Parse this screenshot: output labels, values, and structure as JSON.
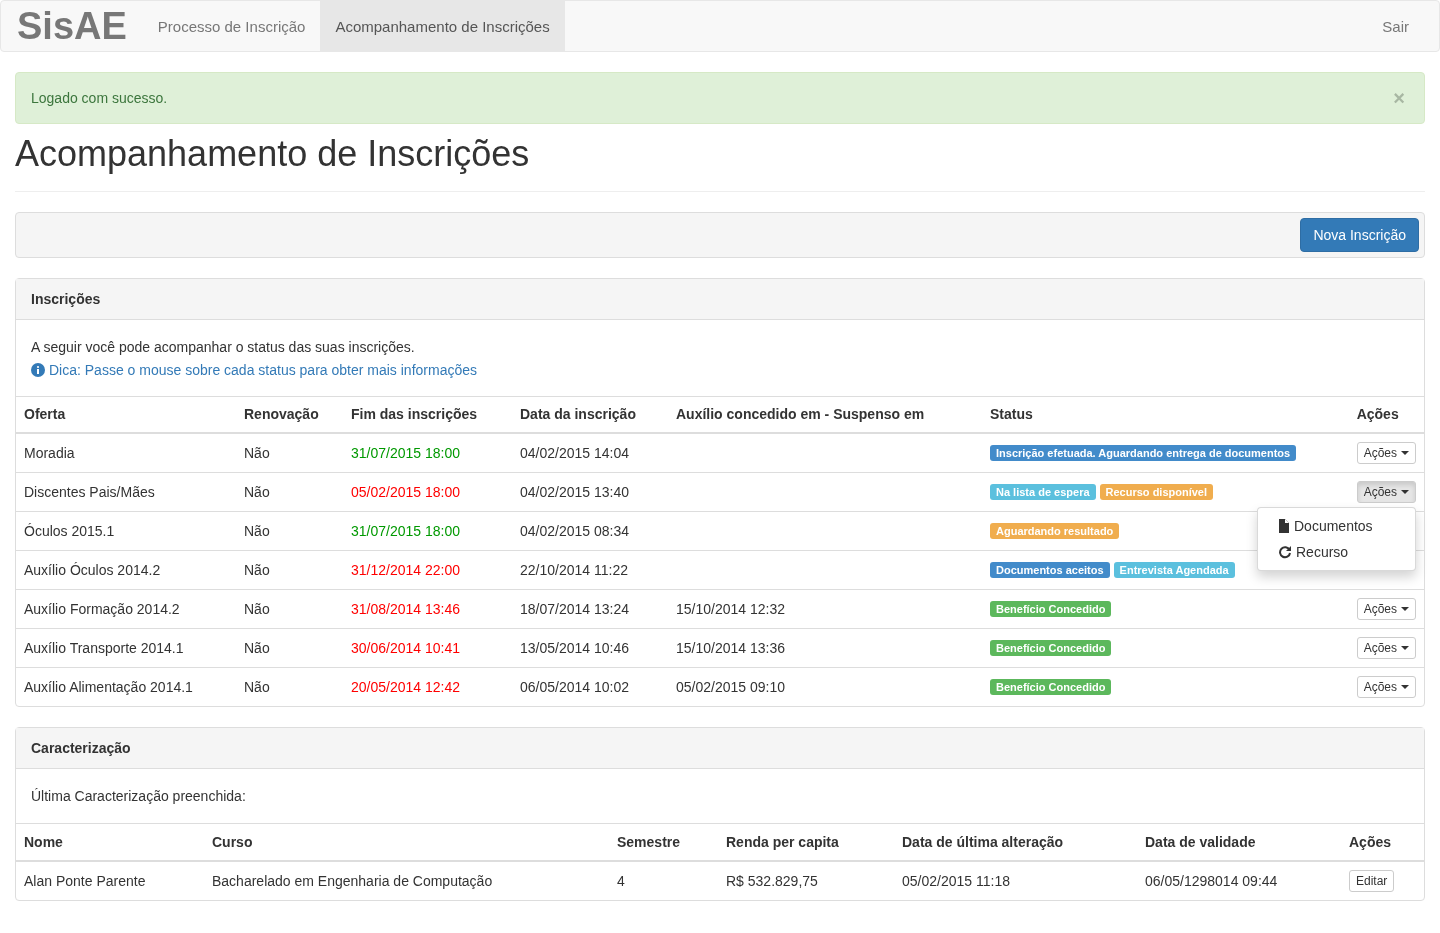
{
  "navbar": {
    "brand": "SisAE",
    "links": [
      {
        "label": "Processo de Inscrição",
        "selected": false
      },
      {
        "label": "Acompanhamento de Inscrições",
        "selected": true
      }
    ],
    "logout": "Sair"
  },
  "alert": {
    "message": "Logado com sucesso.",
    "close": "×"
  },
  "page_title": "Acompanhamento de Inscrições",
  "toolbar": {
    "button": "Nova Inscrição"
  },
  "inscricoes": {
    "title": "Inscrições",
    "intro": "A seguir você pode acompanhar o status das suas inscrições.",
    "tip": "Dica: Passe o mouse sobre cada status para obter mais informações",
    "columns": [
      "Oferta",
      "Renovação",
      "Fim das inscrições",
      "Data da inscrição",
      "Auxílio concedido em - Suspenso em",
      "Status",
      "Ações"
    ],
    "rows": [
      {
        "oferta": "Moradia",
        "renovacao": "Não",
        "fim": "31/07/2015 18:00",
        "color": "#009900",
        "data": "04/02/2015 14:04",
        "auxilio": "",
        "status": [
          {
            "label": "Inscrição efetuada. Aguardando entrega de documentos",
            "color": "#428bca"
          }
        ],
        "actions": {
          "label": "Ações",
          "open": false
        }
      },
      {
        "oferta": "Discentes Pais/Mães",
        "renovacao": "Não",
        "fim": "05/02/2015 18:00",
        "color": "#ff0000",
        "data": "04/02/2015 13:40",
        "auxilio": "",
        "status": [
          {
            "label": "Na lista de espera",
            "color": "#5bc0de"
          },
          {
            "label": "Recurso disponível",
            "color": "#f0ad4e"
          }
        ],
        "actions": {
          "label": "Ações",
          "open": true,
          "menu": [
            {
              "label": "Documentos",
              "kind": "file"
            },
            {
              "label": "Recurso",
              "kind": "refresh"
            }
          ]
        }
      },
      {
        "oferta": "Óculos 2015.1",
        "renovacao": "Não",
        "fim": "31/07/2015 18:00",
        "color": "#009900",
        "data": "04/02/2015 08:34",
        "auxilio": "",
        "status": [
          {
            "label": "Aguardando resultado",
            "color": "#f0ad4e"
          }
        ]
      },
      {
        "oferta": "Auxílio Óculos 2014.2",
        "renovacao": "Não",
        "fim": "31/12/2014 22:00",
        "color": "#ff0000",
        "data": "22/10/2014 11:22",
        "auxilio": "",
        "status": [
          {
            "label": "Documentos aceitos",
            "color": "#428bca"
          },
          {
            "label": "Entrevista Agendada",
            "color": "#5bc0de"
          }
        ]
      },
      {
        "oferta": "Auxílio Formação 2014.2",
        "renovacao": "Não",
        "fim": "31/08/2014 13:46",
        "color": "#ff0000",
        "data": "18/07/2014 13:24",
        "auxilio": "15/10/2014 12:32",
        "status": [
          {
            "label": "Benefício Concedido",
            "color": "#5cb85c"
          }
        ],
        "actions": {
          "label": "Ações",
          "open": false
        }
      },
      {
        "oferta": "Auxílio Transporte 2014.1",
        "renovacao": "Não",
        "fim": "30/06/2014 10:41",
        "color": "#ff0000",
        "data": "13/05/2014 10:46",
        "auxilio": "15/10/2014 13:36",
        "status": [
          {
            "label": "Benefício Concedido",
            "color": "#5cb85c"
          }
        ],
        "actions": {
          "label": "Ações",
          "open": false
        }
      },
      {
        "oferta": "Auxílio Alimentação 2014.1",
        "renovacao": "Não",
        "fim": "20/05/2014 12:42",
        "color": "#ff0000",
        "data": "06/05/2014 10:02",
        "auxilio": "05/02/2015 09:10",
        "status": [
          {
            "label": "Benefício Concedido",
            "color": "#5cb85c"
          }
        ],
        "actions": {
          "label": "Ações",
          "open": false
        }
      }
    ]
  },
  "caracterizacao": {
    "title": "Caracterização",
    "intro": "Última Caracterização preenchida:",
    "columns": [
      "Nome",
      "Curso",
      "Semestre",
      "Renda per capita",
      "Data de última alteração",
      "Data de validade",
      "Ações"
    ],
    "rows": [
      {
        "nome": "Alan Ponte Parente",
        "curso": "Bacharelado em Engenharia de Computação",
        "semestre": "4",
        "renda": "R$ 532.829,75",
        "alteracao": "05/02/2015 11:18",
        "validade": "06/05/1298014 09:44",
        "button": "Editar"
      }
    ]
  }
}
